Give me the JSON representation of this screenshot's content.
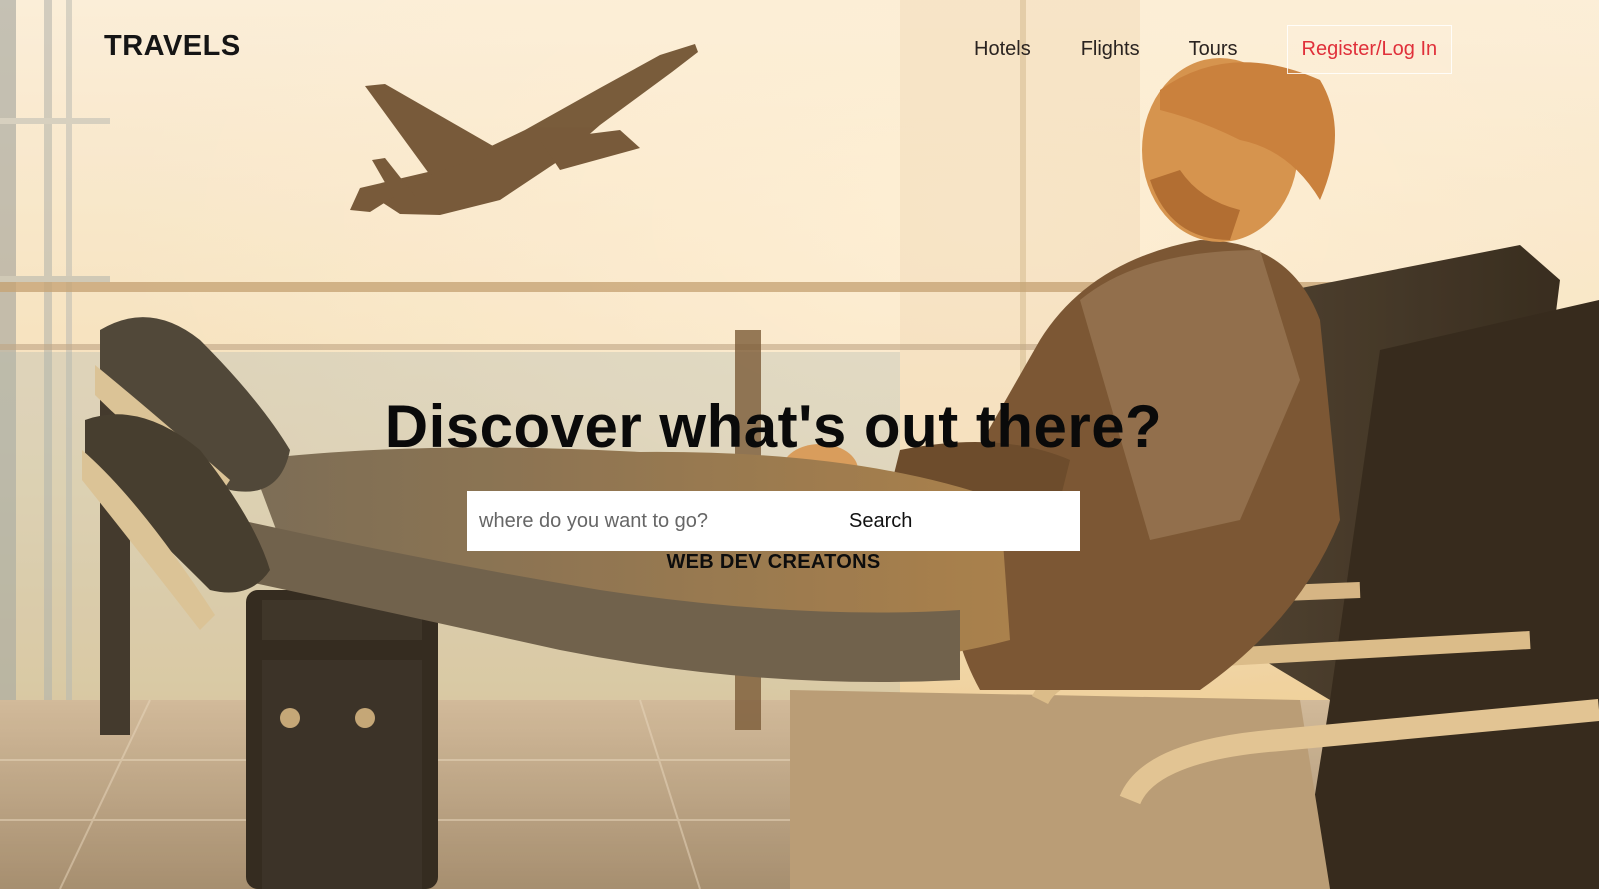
{
  "header": {
    "logo": "TRAVELS",
    "nav": {
      "hotels": "Hotels",
      "flights": "Flights",
      "tours": "Tours",
      "register": "Register/Log In"
    }
  },
  "hero": {
    "headline": "Discover what's out there?",
    "search": {
      "placeholder": "where do you want to go?",
      "value": "",
      "button_label": "Search"
    },
    "credit": "WEB DEV CREATONS"
  },
  "colors": {
    "register_text": "#e0303a",
    "text_dark": "#0a0a0a",
    "search_bg": "#ffffff"
  }
}
